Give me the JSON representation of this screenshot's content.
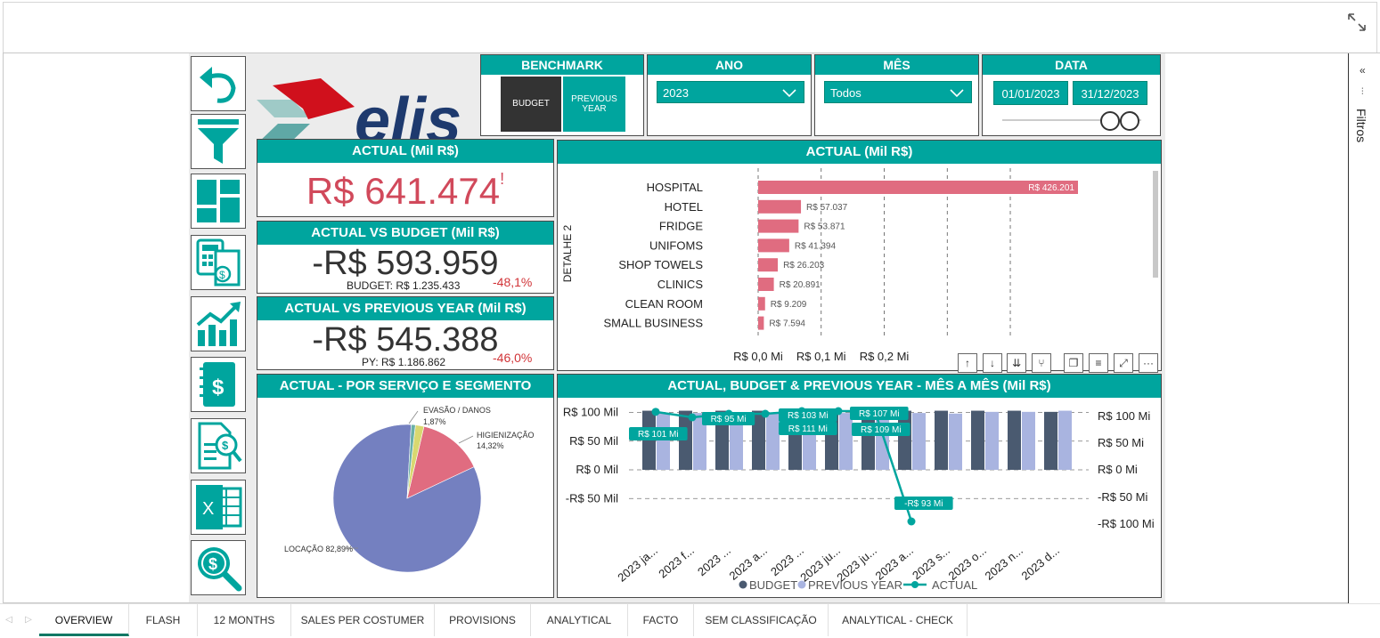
{
  "slicers": {
    "benchmark": {
      "title": "BENCHMARK",
      "budget": "BUDGET",
      "previous": "PREVIOUS YEAR"
    },
    "ano": {
      "title": "ANO",
      "value": "2023"
    },
    "mes": {
      "title": "MÊS",
      "value": "Todos"
    },
    "data": {
      "title": "DATA",
      "start": "01/01/2023",
      "end": "31/12/2023"
    }
  },
  "right_pane": {
    "label": "Filtros"
  },
  "kpis": {
    "actual": {
      "title": "ACTUAL (Mil R$)",
      "value": "R$ 641.474",
      "flag": "!"
    },
    "vs_budget": {
      "title": "ACTUAL VS BUDGET (Mil R$)",
      "value": "-R$ 593.959",
      "sub": "BUDGET: R$ 1.235.433",
      "pct": "-48,1%"
    },
    "vs_py": {
      "title": "ACTUAL VS PREVIOUS YEAR (Mil R$)",
      "value": "-R$ 545.388",
      "sub": "PY: R$ 1.186.862",
      "pct": "-46,0%"
    }
  },
  "bar_chart_title": "ACTUAL (Mil R$)",
  "pie_chart_title": "ACTUAL - POR SERVIÇO E SEGMENTO",
  "combo_chart_title": "ACTUAL, BUDGET & PREVIOUS YEAR - MÊS A MÊS (Mil R$)",
  "tabs": [
    "OVERVIEW",
    "FLASH",
    "12 MONTHS",
    "SALES PER COSTUMER",
    "PROVISIONS",
    "ANALYTICAL",
    "FACTO",
    "SEM CLASSIFICAÇÃO",
    "ANALYTICAL - CHECK"
  ],
  "chart_data": [
    {
      "type": "bar",
      "title": "ACTUAL (Mil R$)",
      "ylabel": "DETALHE 2",
      "categories": [
        "HOSPITAL",
        "HOTEL",
        "FRIDGE",
        "UNIFOMS",
        "SHOP TOWELS",
        "CLINICS",
        "CLEAN ROOM",
        "SMALL BUSINESS"
      ],
      "values": [
        426.201,
        57.037,
        53.871,
        41.394,
        26.203,
        20.891,
        9.209,
        7.594
      ],
      "value_labels": [
        "R$ 426.201",
        "R$ 57.037",
        "R$ 53.871",
        "R$ 41.394",
        "R$ 26.203",
        "R$ 20.891",
        "R$ 9.209",
        "R$ 7.594"
      ],
      "x_ticks": [
        "R$ 0,0 Mi",
        "R$ 0,1 Mi",
        "R$ 0,2 Mi"
      ],
      "xlim": [
        0,
        500
      ],
      "color": "#e06c80"
    },
    {
      "type": "pie",
      "title": "ACTUAL - POR SERVIÇO E SEGMENTO",
      "slices": [
        {
          "label": "LOCAÇÃO 82,89%",
          "value": 82.89,
          "color": "#7480c0"
        },
        {
          "label": "HIGIENIZAÇÃO 14,32%",
          "value": 14.32,
          "color": "#e06c80"
        },
        {
          "label": "EVASÃO / DANOS 1,87%",
          "value": 1.87,
          "color": "#d8d870"
        },
        {
          "label": "",
          "value": 0.92,
          "color": "#6ab0a8"
        }
      ]
    },
    {
      "type": "bar",
      "title": "ACTUAL, BUDGET & PREVIOUS YEAR - MÊS A MÊS (Mil R$)",
      "categories": [
        "2023 ja...",
        "2023 f...",
        "2023 ...",
        "2023 a...",
        "2023 ...",
        "2023 ju...",
        "2023 ju...",
        "2023 a...",
        "2023 s...",
        "2023 o...",
        "2023 n...",
        "2023 d..."
      ],
      "series": [
        {
          "name": "BUDGET",
          "color": "#4a5a70",
          "values": [
            103,
            103,
            103,
            103,
            103,
            103,
            103,
            103,
            103,
            103,
            103,
            101
          ]
        },
        {
          "name": "PREVIOUS YEAR",
          "color": "#a9b4e0",
          "values": [
            99,
            99,
            99,
            99,
            99,
            99,
            99,
            99,
            98,
            101,
            101,
            103
          ]
        },
        {
          "name": "ACTUAL",
          "color": "#00a59e",
          "values": [
            101,
            95,
            95,
            103,
            111,
            107,
            109,
            -93
          ]
        }
      ],
      "point_labels": [
        "R$ 101 Mi",
        "R$ 95 Mi",
        "R$ 103 Mi",
        "R$ 111 Mi",
        "R$ 107 Mi",
        "R$ 109 Mi",
        "-R$ 93 Mi"
      ],
      "y_ticks_left": [
        "R$ 100 Mil",
        "R$ 50 Mil",
        "R$ 0 Mil",
        "-R$ 50 Mil"
      ],
      "y_ticks_right": [
        "R$ 100 Mi",
        "R$ 50 Mi",
        "R$ 0 Mi",
        "-R$ 50 Mi",
        "-R$ 100 Mi"
      ],
      "legend": "bottom"
    }
  ]
}
